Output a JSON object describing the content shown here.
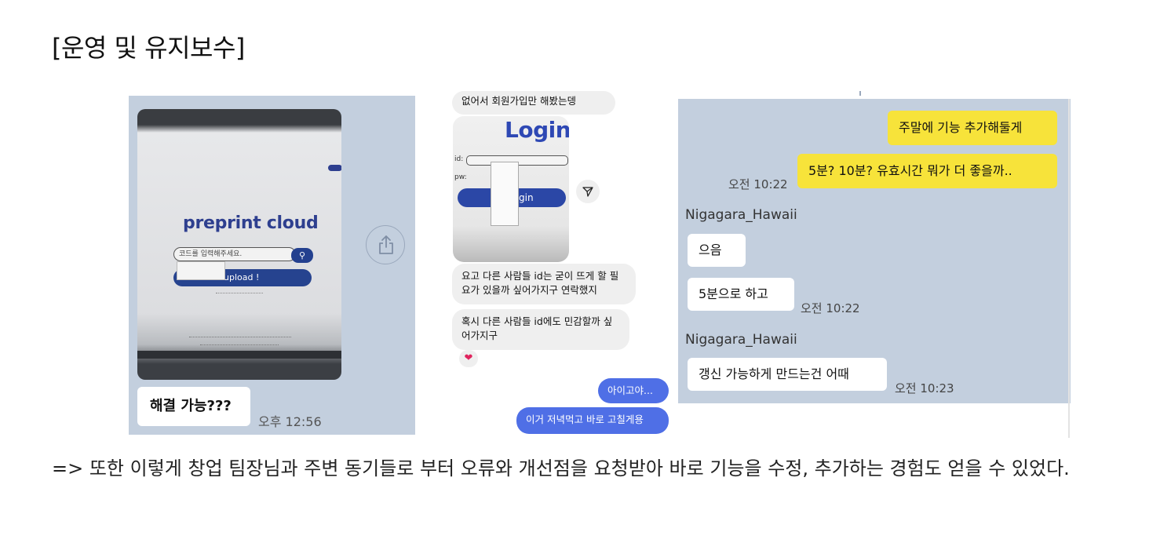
{
  "heading": "[운영 및 유지보수]",
  "panel_left": {
    "photo": {
      "title": "preprint cloud",
      "input_placeholder": "코드를 입력해주세요.",
      "upload_label": "upload !"
    },
    "bubble": "해결 가능???",
    "time": "오후 12:56",
    "share_icon": "share-icon"
  },
  "panel_middle": {
    "top_message": "없어서 회원가입만 해봤는뎅",
    "photo": {
      "title": "Login",
      "id_label": "id:",
      "pw_label": "pw:",
      "button_label": "gin"
    },
    "message_1": "요고 다른 사람들 id는 굳이 뜨게 할 필요가 있을까 싶어가지구 연락했지",
    "message_2": "혹시 다른 사람들 id에도 민감할까 싶어가지구",
    "reaction": "❤",
    "reply_1": "아이고야...",
    "reply_2": "이거 저녁먹고 바로 고칠게용"
  },
  "panel_right": {
    "sent_1": "주말에 기능 추가해둘게",
    "sent_2": "5분? 10분? 유효시간 뭐가 더 좋을까..",
    "sent_time": "오전 10:22",
    "sender_1": "Nigagara_Hawaii",
    "recv_1": "으음",
    "recv_2": "5분으로 하고",
    "recv_2_time": "오전 10:22",
    "sender_2": "Nigagara_Hawaii",
    "recv_3": "갱신 가능하게 만드는건 어때",
    "recv_3_time": "오전 10:23"
  },
  "caption": "=> 또한 이렇게 창업 팀장님과 주변 동기들로 부터 오류와 개선점을 요청받아 바로 기능을 수정, 추가하는 경험도 얻을 수 있었다."
}
